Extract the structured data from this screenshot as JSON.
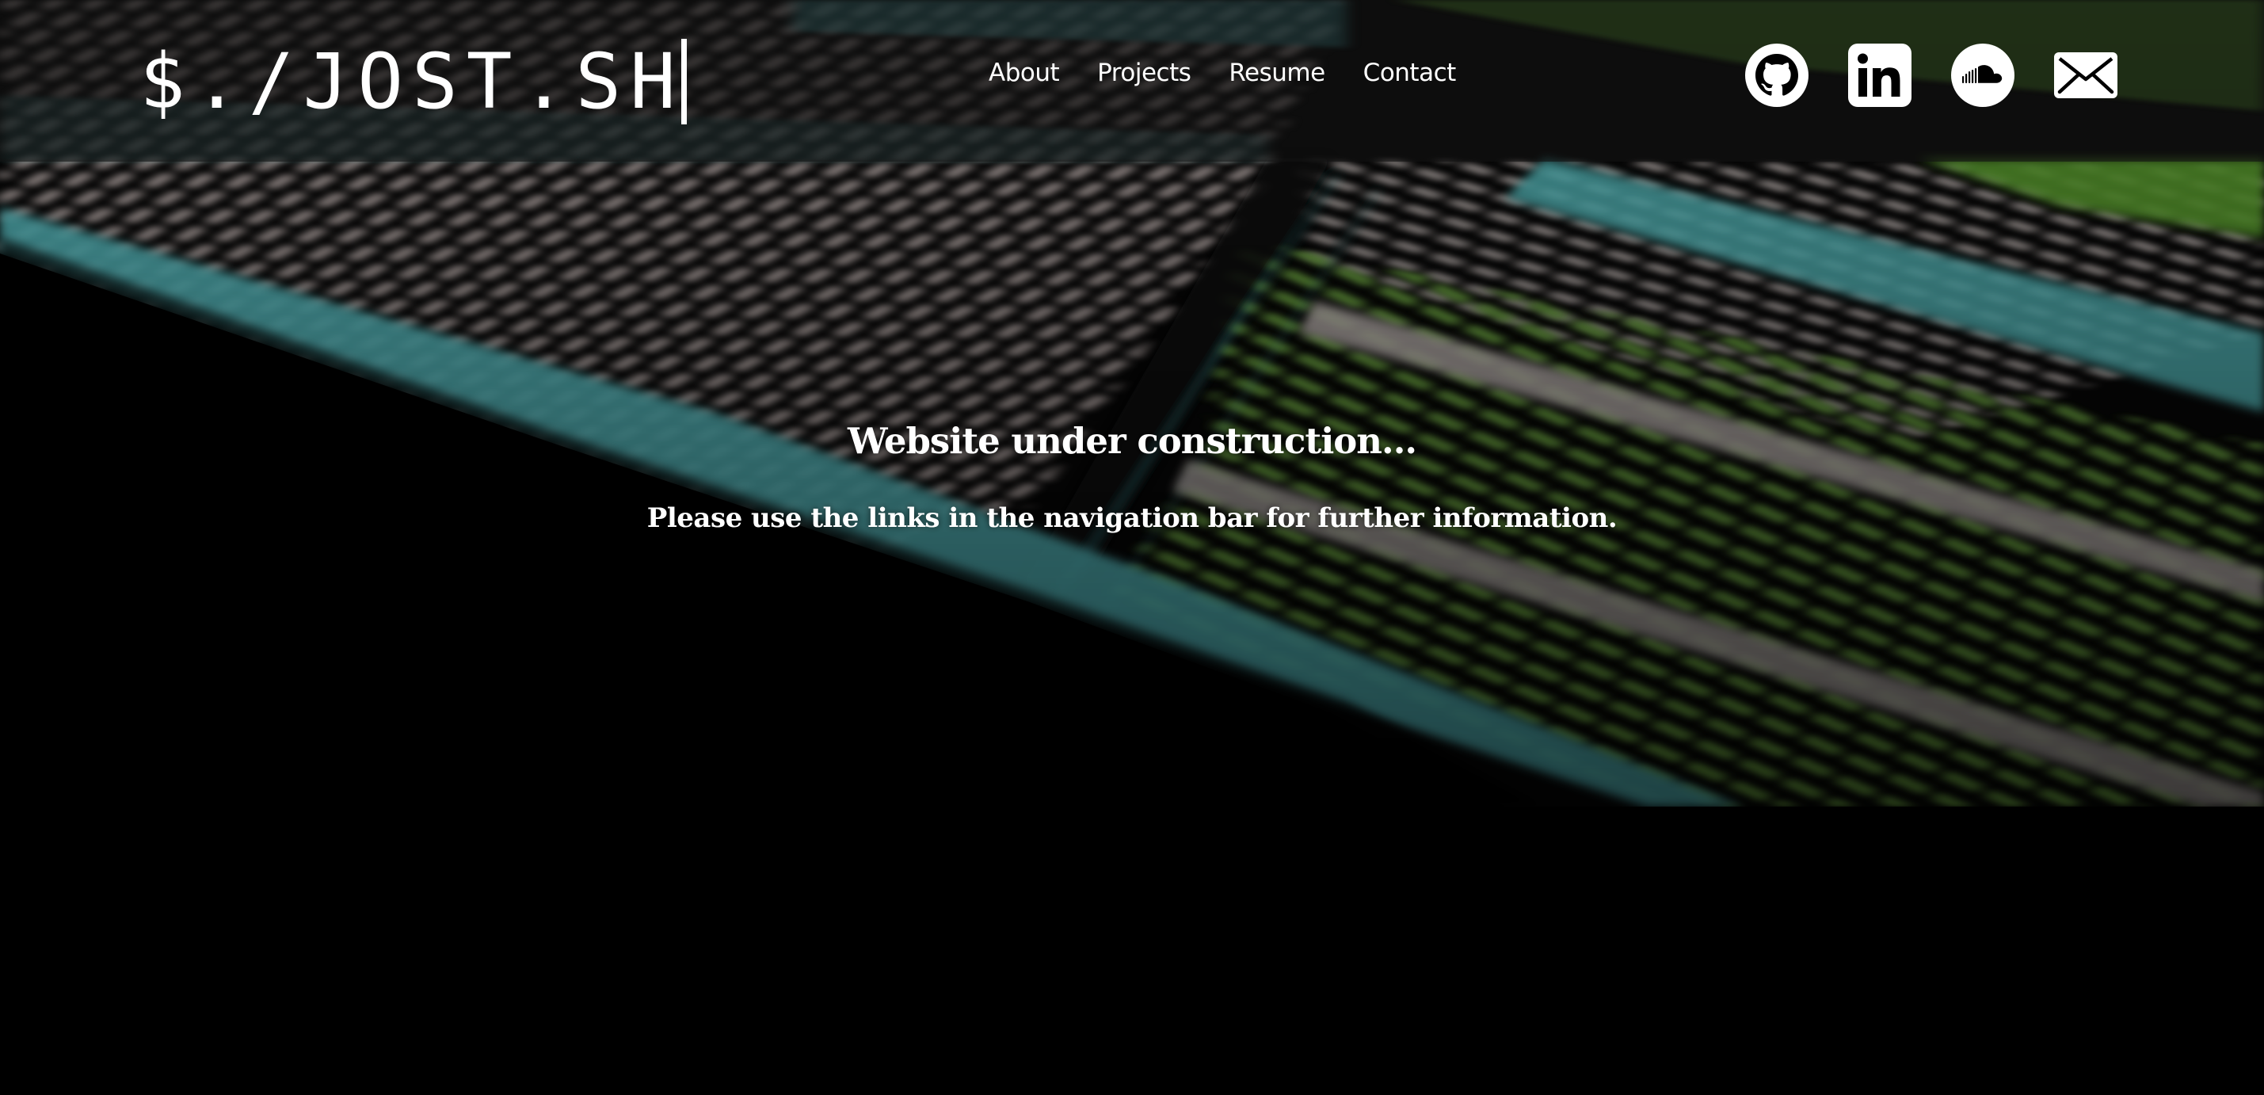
{
  "site": {
    "logo_text": "$./JOST.SH"
  },
  "nav": {
    "items": [
      {
        "label": "About"
      },
      {
        "label": "Projects"
      },
      {
        "label": "Resume"
      },
      {
        "label": "Contact"
      }
    ]
  },
  "social": {
    "icons": [
      "github-icon",
      "linkedin-icon",
      "soundcloud-icon",
      "mail-icon"
    ]
  },
  "hero": {
    "headline": "Website under construction...",
    "subline": "Please use the links in the navigation bar for further information."
  },
  "colors": {
    "background": "#000000",
    "text": "#ffffff",
    "teal": "#4aa3a6",
    "green": "#5a8a3a",
    "grey": "#9a9494"
  }
}
